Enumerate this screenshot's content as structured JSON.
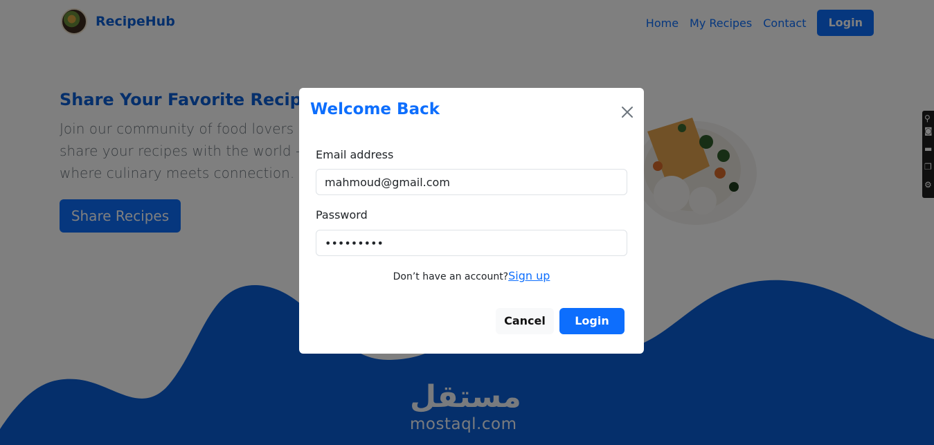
{
  "navbar": {
    "brand": "RecipeHub",
    "links": [
      "Home",
      "My Recipes",
      "Contact"
    ],
    "login_label": "Login"
  },
  "hero": {
    "title": "Share Your Favorite Recipes",
    "text": "Join our community of food lovers and share your recipes with the world — where culinary meets connection.",
    "button_label": "Share Recipes"
  },
  "modal": {
    "title": "Welcome Back",
    "email_label": "Email address",
    "email_value": "mahmoud@gmail.com",
    "password_label": "Password",
    "password_value": "•••••••••",
    "signup_prompt": "Don’t have an account?",
    "signup_link": "Sign up",
    "cancel_label": "Cancel",
    "login_label": "Login"
  },
  "watermark": {
    "arabic": "مستقل",
    "latin": "mostaql.com"
  },
  "colors": {
    "primary": "#0d6efd",
    "wave": "#0b5ed7",
    "overlay": "rgba(0,0,0,0.5)"
  }
}
